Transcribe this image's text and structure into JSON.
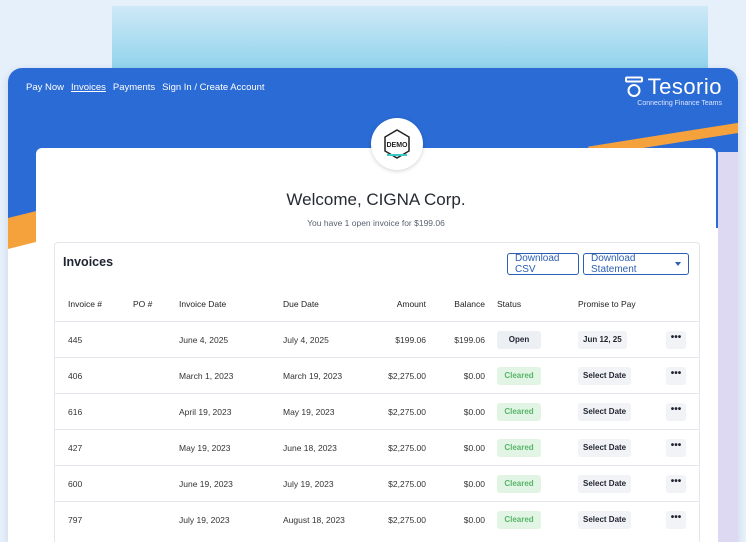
{
  "nav": {
    "items": [
      "Pay Now",
      "Invoices",
      "Payments",
      "Sign In / Create Account"
    ],
    "active": "Invoices"
  },
  "brand": {
    "name": "Tesorio",
    "tagline": "Connecting Finance Teams"
  },
  "badge": {
    "text": "DEMO"
  },
  "welcome": {
    "title": "Welcome, CIGNA Corp.",
    "subtitle": "You have 1 open invoice for $199.06"
  },
  "invoices": {
    "title": "Invoices",
    "download_csv": "Download CSV",
    "download_statement": "Download Statement",
    "columns": {
      "invoice": "Invoice #",
      "po": "PO #",
      "invoice_date": "Invoice Date",
      "due_date": "Due Date",
      "amount": "Amount",
      "balance": "Balance",
      "status": "Status",
      "promise": "Promise to Pay"
    },
    "rows": [
      {
        "invoice": "445",
        "po": "",
        "invoice_date": "June 4, 2025",
        "due_date": "July 4, 2025",
        "amount": "$199.06",
        "balance": "$199.06",
        "status": "Open",
        "promise": "Jun 12, 25"
      },
      {
        "invoice": "406",
        "po": "",
        "invoice_date": "March 1, 2023",
        "due_date": "March 19, 2023",
        "amount": "$2,275.00",
        "balance": "$0.00",
        "status": "Cleared",
        "promise": "Select Date"
      },
      {
        "invoice": "616",
        "po": "",
        "invoice_date": "April 19, 2023",
        "due_date": "May 19, 2023",
        "amount": "$2,275.00",
        "balance": "$0.00",
        "status": "Cleared",
        "promise": "Select Date"
      },
      {
        "invoice": "427",
        "po": "",
        "invoice_date": "May 19, 2023",
        "due_date": "June 18, 2023",
        "amount": "$2,275.00",
        "balance": "$0.00",
        "status": "Cleared",
        "promise": "Select Date"
      },
      {
        "invoice": "600",
        "po": "",
        "invoice_date": "June 19, 2023",
        "due_date": "July 19, 2023",
        "amount": "$2,275.00",
        "balance": "$0.00",
        "status": "Cleared",
        "promise": "Select Date"
      },
      {
        "invoice": "797",
        "po": "",
        "invoice_date": "July 19, 2023",
        "due_date": "August 18, 2023",
        "amount": "$2,275.00",
        "balance": "$0.00",
        "status": "Cleared",
        "promise": "Select Date"
      }
    ],
    "more_label": "•••"
  },
  "colors": {
    "banner": "#2b6bd6",
    "accent_orange": "#f5a23c",
    "link_blue": "#2b5fb3",
    "cleared_green": "#58b56a"
  }
}
